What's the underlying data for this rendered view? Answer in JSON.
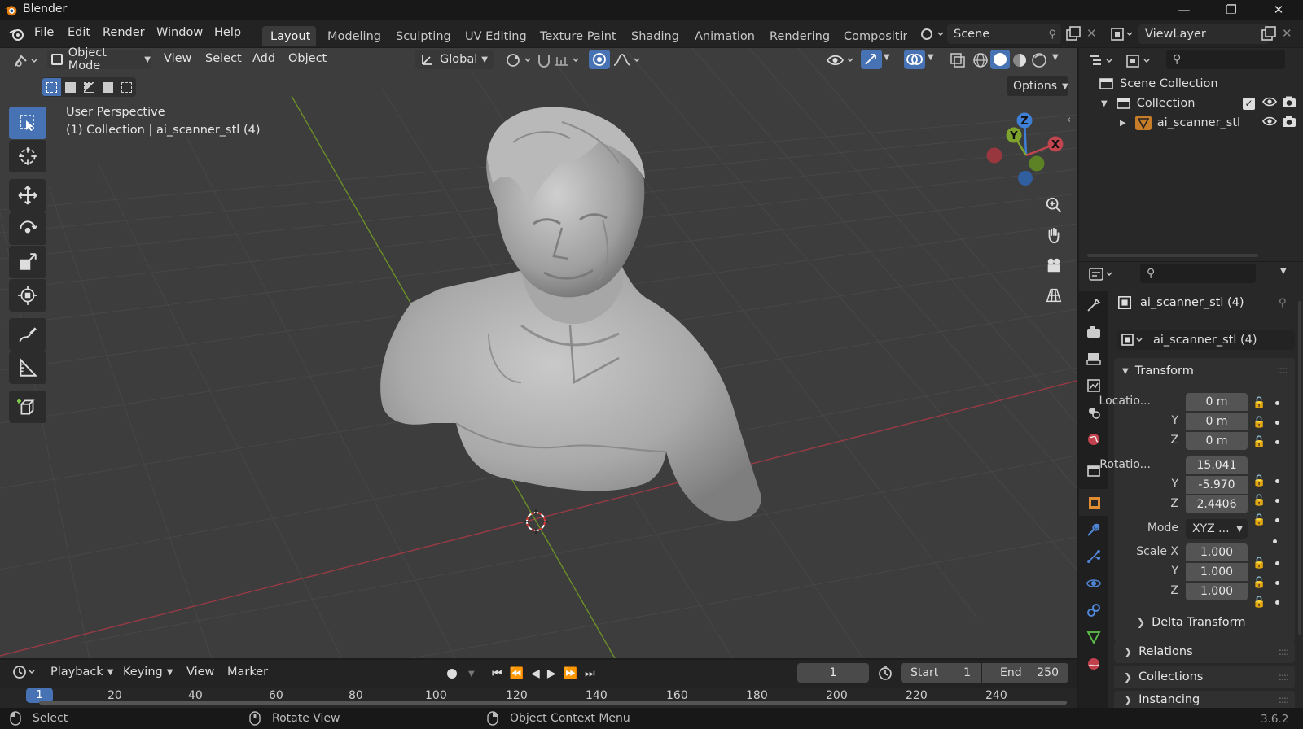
{
  "window": {
    "title": "Blender"
  },
  "menubar": {
    "menus": [
      "File",
      "Edit",
      "Render",
      "Window",
      "Help"
    ],
    "workspaces": [
      "Layout",
      "Modeling",
      "Sculpting",
      "UV Editing",
      "Texture Paint",
      "Shading",
      "Animation",
      "Rendering",
      "Compositin"
    ],
    "active_workspace": "Layout",
    "scene": "Scene",
    "view_layer": "ViewLayer"
  },
  "viewport_header": {
    "mode": "Object Mode",
    "menus": [
      "View",
      "Select",
      "Add",
      "Object"
    ],
    "orientation": "Global",
    "options": "Options"
  },
  "viewport": {
    "overlay_line1": "User Perspective",
    "overlay_line2": "(1) Collection | ai_scanner_stl (4)",
    "gizmo_axes": {
      "x": "X",
      "y": "Y",
      "z": "Z"
    }
  },
  "outliner": {
    "root": "Scene Collection",
    "collection": "Collection",
    "object": "ai_scanner_stl"
  },
  "properties": {
    "object_name": "ai_scanner_stl (4)",
    "datablock": "ai_scanner_stl (4)",
    "transform_title": "Transform",
    "location_label": "Locatio...",
    "location": {
      "x": "0 m",
      "y": "0 m",
      "z": "0 m"
    },
    "rotation_label": "Rotatio...",
    "rotation": {
      "x": "15.041",
      "y": "-5.970",
      "z": "2.4406"
    },
    "mode_label": "Mode",
    "mode_value": "XYZ ...",
    "scale_label": "Scale X",
    "scale": {
      "x": "1.000",
      "y": "1.000",
      "z": "1.000"
    },
    "axis_y": "Y",
    "axis_z": "Z",
    "subpanels": [
      "Delta Transform",
      "Relations",
      "Collections",
      "Instancing"
    ]
  },
  "timeline": {
    "menus": [
      "Playback",
      "Keying",
      "View",
      "Marker"
    ],
    "current_frame": "1",
    "start_label": "Start",
    "start": "1",
    "end_label": "End",
    "end": "250",
    "ruler": [
      "20",
      "40",
      "60",
      "80",
      "100",
      "120",
      "140",
      "160",
      "180",
      "200",
      "220",
      "240"
    ],
    "playhead": "1"
  },
  "statusbar": {
    "select": "Select",
    "rotate": "Rotate View",
    "context": "Object Context Menu",
    "version": "3.6.2"
  },
  "colors": {
    "accent": "#4772b3",
    "x_axis": "#c0454f",
    "y_axis": "#7ea32d",
    "z_axis": "#3f7fd6",
    "object_orange": "#e38d33"
  }
}
